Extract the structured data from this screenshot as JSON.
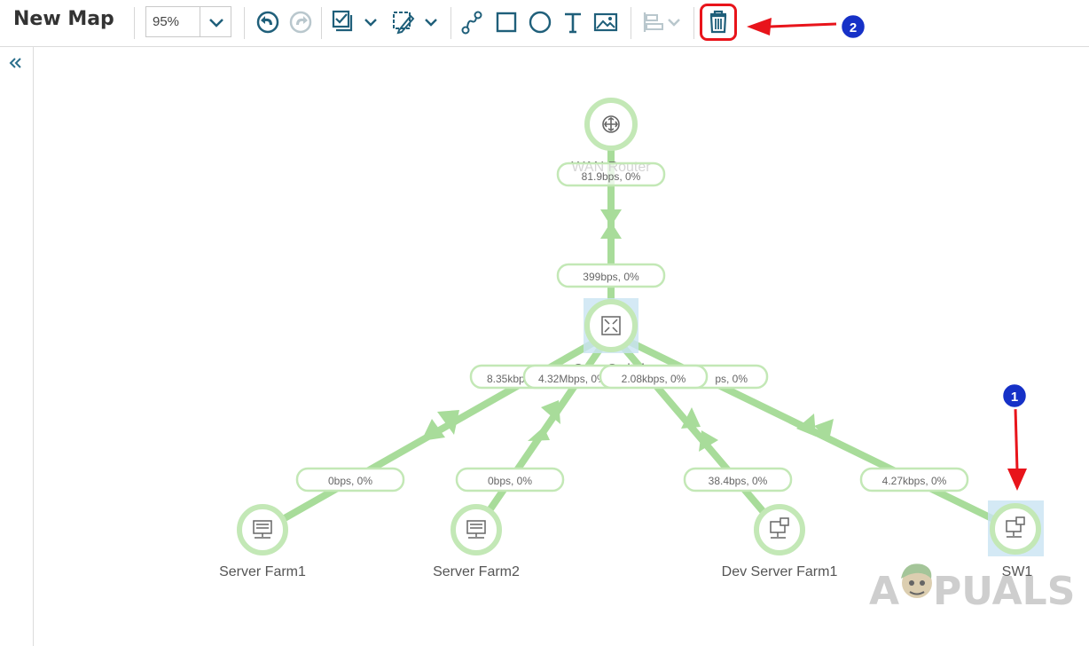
{
  "toolbar": {
    "title": "New Map",
    "zoom_value": "95%"
  },
  "map": {
    "nodes": [
      {
        "id": "wan-router",
        "label": "WAN Router",
        "icon": "router-icon"
      },
      {
        "id": "core-switch",
        "label": "Core Switch",
        "icon": "switch-icon"
      },
      {
        "id": "server-farm1",
        "label": "Server Farm1",
        "icon": "server-icon"
      },
      {
        "id": "server-farm2",
        "label": "Server Farm2",
        "icon": "server-icon"
      },
      {
        "id": "dev-server-farm1",
        "label": "Dev Server Farm1",
        "icon": "network-device-icon"
      },
      {
        "id": "sw1",
        "label": "SW1",
        "icon": "network-device-icon"
      }
    ],
    "links": [
      {
        "id": "wan-up",
        "label": "81.9bps, 0%"
      },
      {
        "id": "wan-down",
        "label": "399bps, 0%"
      },
      {
        "id": "core-sf1",
        "label": "8.35kbps, 0%"
      },
      {
        "id": "core-sf2",
        "label": "4.32Mbps, 0%"
      },
      {
        "id": "core-dev",
        "label": "2.08kbps, 0%"
      },
      {
        "id": "core-sw1",
        "label": "ps, 0%"
      },
      {
        "id": "sf1-up",
        "label": "0bps, 0%"
      },
      {
        "id": "sf2-up",
        "label": "0bps, 0%"
      },
      {
        "id": "dev-up",
        "label": "38.4bps, 0%"
      },
      {
        "id": "sw1-up",
        "label": "4.27kbps, 0%"
      }
    ]
  },
  "annotations": {
    "marker1": "1",
    "marker2": "2"
  },
  "watermark": {
    "text_left": "A",
    "text_right": "PUALS"
  },
  "colors": {
    "link": "#a8dc9a",
    "node_ring": "#c3e8b6",
    "selection": "#c9e4f2",
    "icons": "#1f5f7a",
    "callout_red": "#e8141b",
    "badge_blue": "#1631c7"
  }
}
